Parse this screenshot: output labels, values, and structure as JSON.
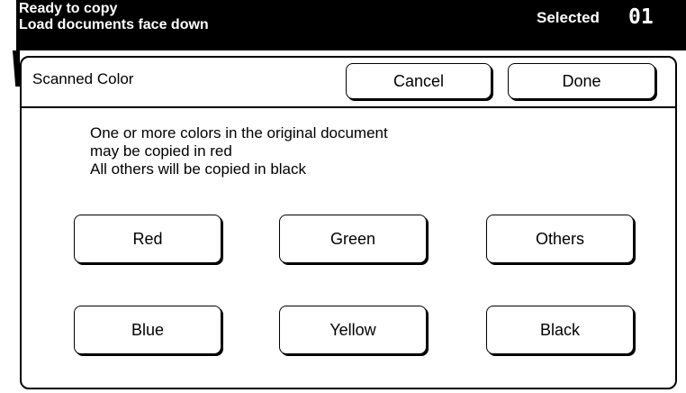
{
  "status": {
    "line1": "Ready to copy",
    "line2": "Load documents face down",
    "selected_label": "Selected",
    "selected_count": "01"
  },
  "dialog": {
    "title": "Scanned Color",
    "cancel_label": "Cancel",
    "done_label": "Done",
    "message": [
      "One or more colors in the original document",
      "may be copied in red",
      "All others will be copied in black"
    ],
    "colors": [
      {
        "label": "Red"
      },
      {
        "label": "Green"
      },
      {
        "label": "Others"
      },
      {
        "label": "Blue"
      },
      {
        "label": "Yellow"
      },
      {
        "label": "Black"
      }
    ]
  }
}
